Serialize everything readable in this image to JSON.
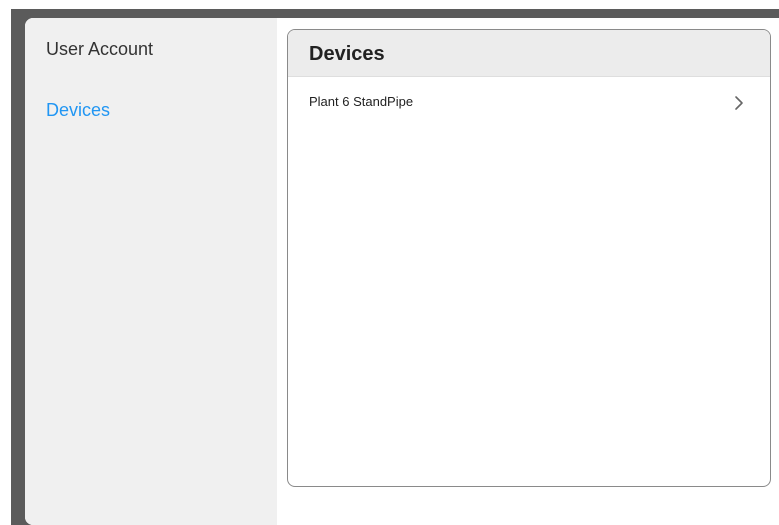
{
  "sidebar": {
    "items": [
      {
        "label": "User Account",
        "selected": false
      },
      {
        "label": "Devices",
        "selected": true
      }
    ],
    "selected_color": "#2196f3"
  },
  "panel": {
    "title": "Devices",
    "devices": [
      {
        "name": "Plant 6 StandPipe",
        "icon": "chevron-right-icon"
      }
    ]
  }
}
